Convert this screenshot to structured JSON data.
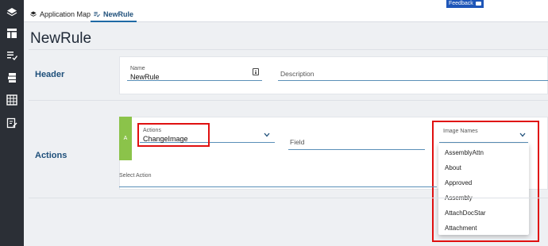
{
  "tabs": [
    {
      "label": "Application Map",
      "icon": "layers-icon"
    },
    {
      "label": "NewRule",
      "icon": "rule-icon"
    }
  ],
  "feedback": {
    "label": "Feedback"
  },
  "page": {
    "title": "NewRule"
  },
  "header_section": {
    "label": "Header",
    "name_label": "Name",
    "name_value": "NewRule",
    "description_placeholder": "Description"
  },
  "actions_section": {
    "label": "Actions",
    "badge": "A",
    "actions_label": "Actions",
    "actions_value": "ChangeImage",
    "field_placeholder": "Field",
    "image_names_label": "Image Names",
    "select_action_label": "Select Action",
    "image_options": [
      "AssemblyAttn",
      "About",
      "Approved",
      "Assembly",
      "AttachDocStar",
      "Attachment"
    ]
  },
  "colors": {
    "highlight": "#e01010",
    "accent": "#1f6aa5",
    "badge": "#8bc34a"
  }
}
